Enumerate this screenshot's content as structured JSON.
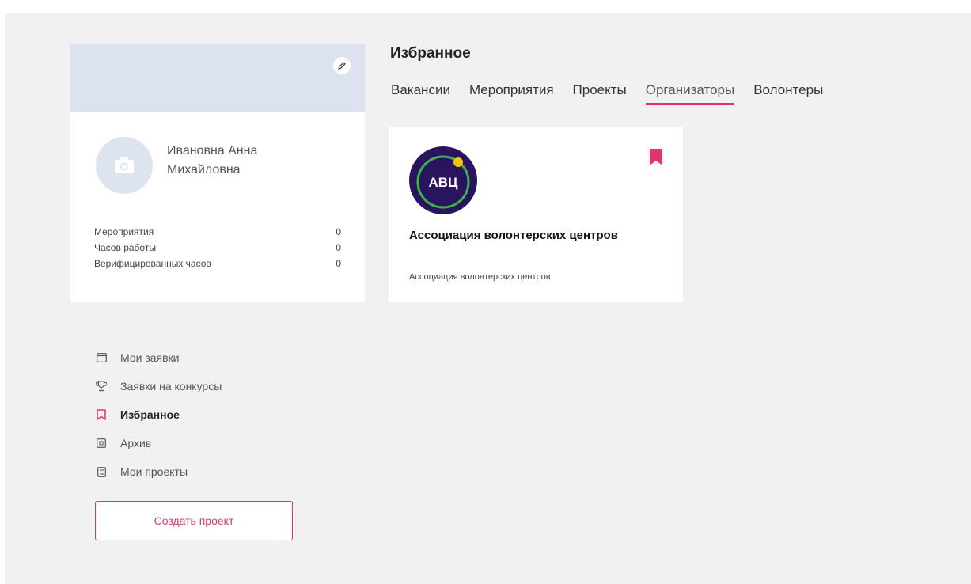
{
  "profile": {
    "name_line1": "Ивановна Анна",
    "name_line2": "Михайловна",
    "stats": [
      {
        "label": "Мероприятия",
        "value": "0"
      },
      {
        "label": "Часов работы",
        "value": "0"
      },
      {
        "label": "Верифицированных часов",
        "value": "0"
      }
    ]
  },
  "menu": {
    "items": [
      {
        "label": "Мои заявки",
        "icon": "calendar-icon"
      },
      {
        "label": "Заявки на конкурсы",
        "icon": "trophy-icon"
      },
      {
        "label": "Избранное",
        "icon": "bookmark-icon",
        "active": true
      },
      {
        "label": "Архив",
        "icon": "archive-icon"
      },
      {
        "label": "Мои проекты",
        "icon": "document-icon"
      }
    ],
    "create_label": "Создать проект"
  },
  "favorites": {
    "title": "Избранное",
    "tabs": [
      "Вакансии",
      "Мероприятия",
      "Проекты",
      "Организаторы",
      "Волонтеры"
    ],
    "active_tab": "Организаторы"
  },
  "org_card": {
    "logo_text": "АВЦ",
    "title": "Ассоциация волонтерских центров",
    "subtitle": "Ассоциация волонтерских центров"
  },
  "colors": {
    "accent": "#e0356f",
    "logo_bg": "#2a1460",
    "logo_ring": "#3bb34a",
    "logo_dot": "#f5c400",
    "background": "#f1f1f1",
    "cover": "#dce3ef"
  }
}
